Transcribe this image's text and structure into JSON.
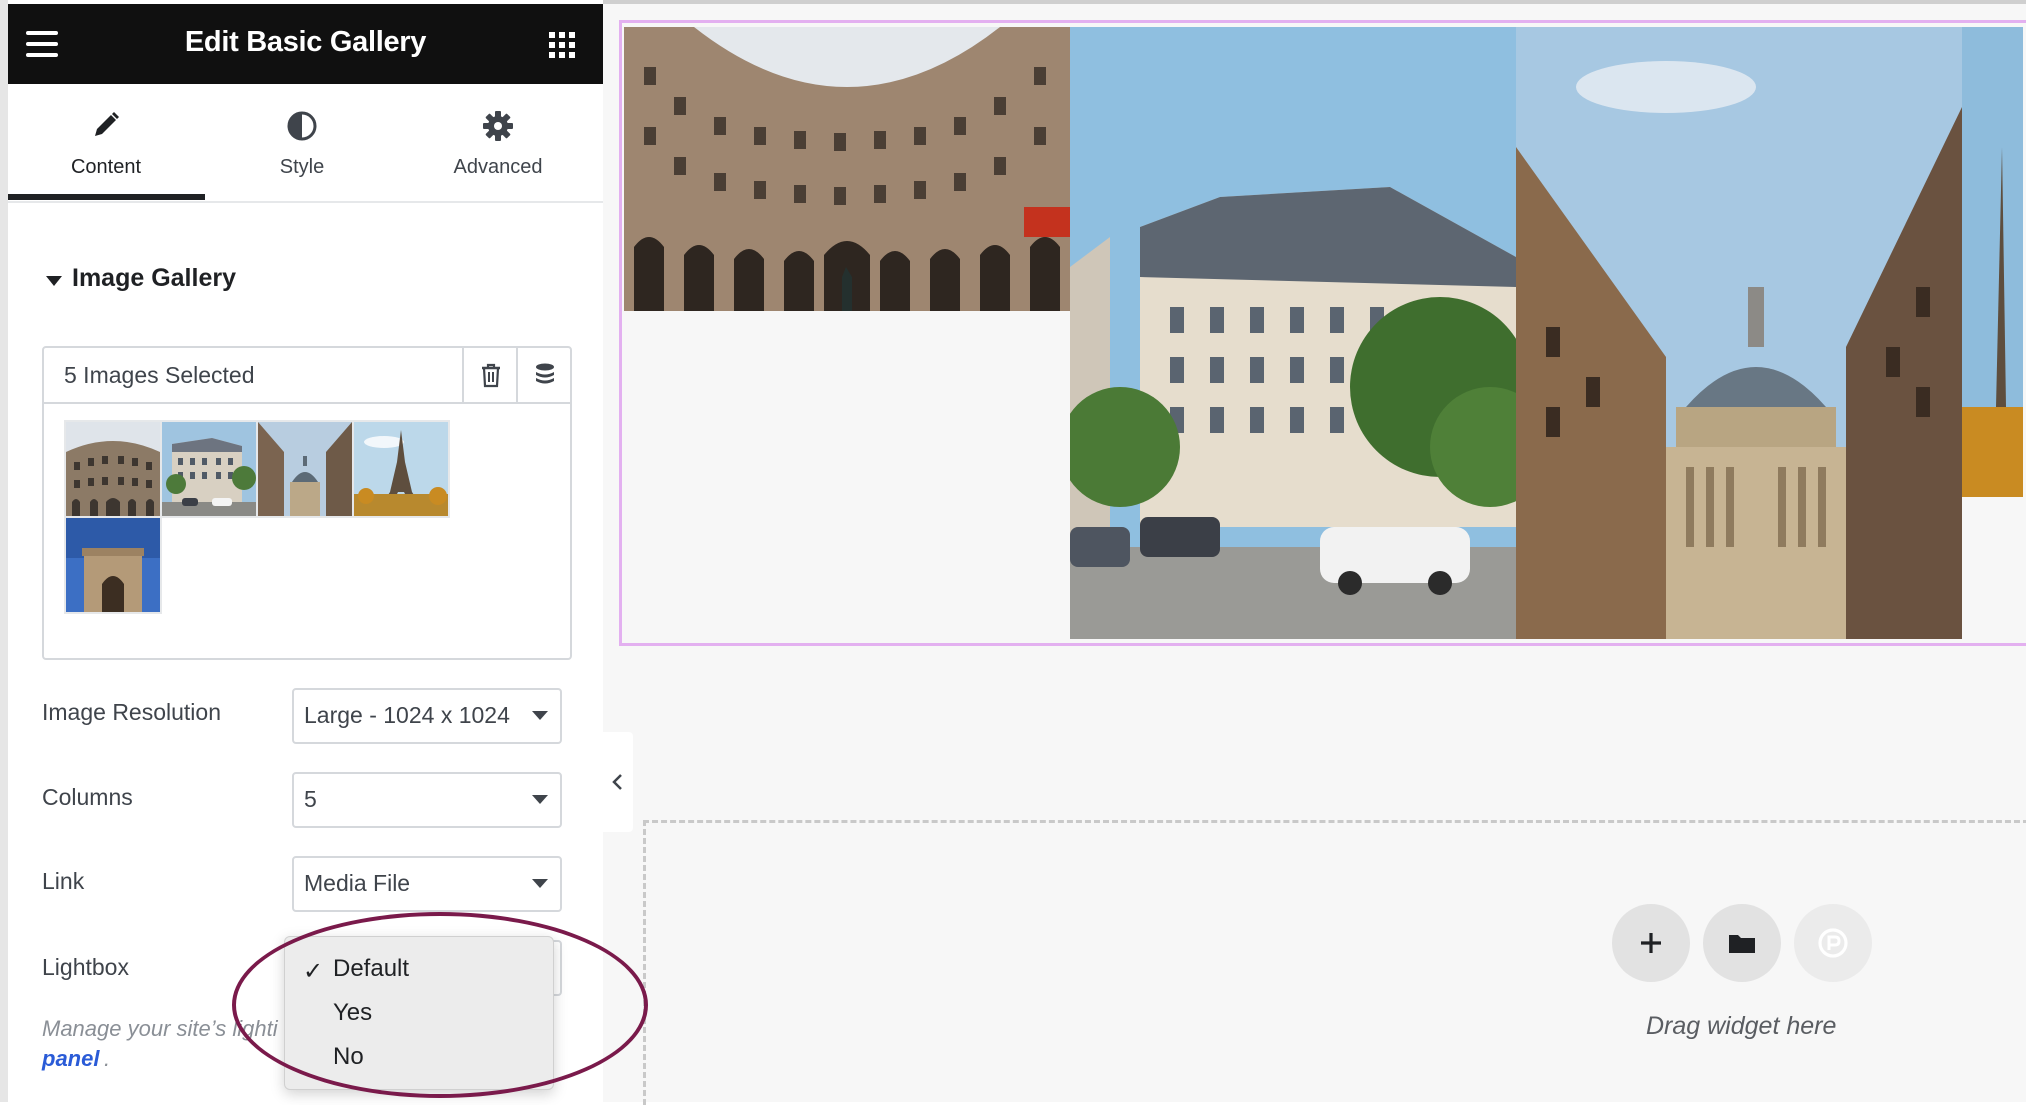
{
  "header": {
    "title": "Edit Basic Gallery"
  },
  "tabs": [
    {
      "label": "Content",
      "icon": "pencil-icon",
      "active": true
    },
    {
      "label": "Style",
      "icon": "contrast-icon",
      "active": false
    },
    {
      "label": "Advanced",
      "icon": "gear-icon",
      "active": false
    }
  ],
  "section": {
    "title": "Image Gallery"
  },
  "gallery": {
    "count_label": "5 Images Selected",
    "thumbnails": [
      "courtyard",
      "street-building",
      "pantheon-street",
      "eiffel-tower",
      "arc-de-triomphe"
    ]
  },
  "controls": {
    "image_resolution": {
      "label": "Image Resolution",
      "value": "Large - 1024 x 1024"
    },
    "columns": {
      "label": "Columns",
      "value": "5"
    },
    "link": {
      "label": "Link",
      "value": "Media File"
    },
    "lightbox": {
      "label": "Lightbox"
    }
  },
  "lightbox_menu": {
    "options": [
      "Default",
      "Yes",
      "No"
    ],
    "selected": "Default"
  },
  "note": {
    "text": "Manage your site’s lighti",
    "link": "panel",
    "trail": "."
  },
  "canvas": {
    "drag_text": "Drag widget here"
  },
  "colors": {
    "header_bg": "#101010",
    "widget_outline": "#e3b0f0",
    "link_color": "#2a5bd7",
    "annotation": "#7a1a4b"
  }
}
